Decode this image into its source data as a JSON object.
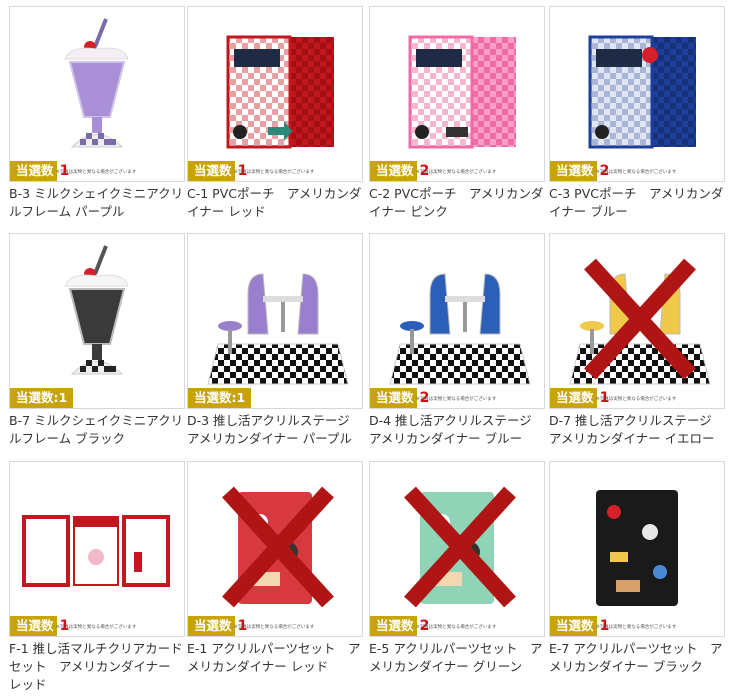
{
  "note_text": "※写真は実物と異なる場合がございます",
  "items": [
    {
      "caption": "B-3 ミルクシェイクミニアクリルフレーム パープル",
      "badge_label": "当選数",
      "count": "1",
      "inline": false,
      "sold_out": false
    },
    {
      "caption": "C-1 PVCポーチ　アメリカンダイナー レッド",
      "badge_label": "当選数",
      "count": "1",
      "inline": false,
      "sold_out": false
    },
    {
      "caption": "C-2 PVCポーチ　アメリカンダイナー ピンク",
      "badge_label": "当選数",
      "count": "2",
      "inline": false,
      "sold_out": false
    },
    {
      "caption": "C-3 PVCポーチ　アメリカンダイナー ブルー",
      "badge_label": "当選数",
      "count": "2",
      "inline": false,
      "sold_out": false
    },
    {
      "caption": "B-7 ミルクシェイクミニアクリルフレーム ブラック",
      "badge_label": "当選数:1",
      "count": "",
      "inline": true,
      "sold_out": false
    },
    {
      "caption": "D-3 推し活アクリルステージ アメリカンダイナー パープル",
      "badge_label": "当選数:1",
      "count": "",
      "inline": true,
      "sold_out": false
    },
    {
      "caption": "D-4 推し活アクリルステージ アメリカンダイナー ブルー",
      "badge_label": "当選数",
      "count": "2",
      "inline": false,
      "sold_out": false
    },
    {
      "caption": "D-7 推し活アクリルステージ アメリカンダイナー イエロー",
      "badge_label": "当選数",
      "count": "1",
      "inline": false,
      "sold_out": true
    },
    {
      "caption": "F-1 推し活マルチクリアカードセット　アメリカンダイナー レッド",
      "badge_label": "当選数",
      "count": "1",
      "inline": false,
      "sold_out": false
    },
    {
      "caption": "E-1 アクリルパーツセット　アメリカンダイナー レッド",
      "badge_label": "当選数",
      "count": "1",
      "inline": false,
      "sold_out": true
    },
    {
      "caption": "E-5 アクリルパーツセット　アメリカンダイナー グリーン",
      "badge_label": "当選数",
      "count": "2",
      "inline": false,
      "sold_out": true
    },
    {
      "caption": "E-7 アクリルパーツセット　アメリカンダイナー ブラック",
      "badge_label": "当選数",
      "count": "1",
      "inline": false,
      "sold_out": false
    }
  ],
  "colors": {
    "badge": "#c9a30a",
    "count": "#d21010",
    "cross": "#b01515"
  }
}
